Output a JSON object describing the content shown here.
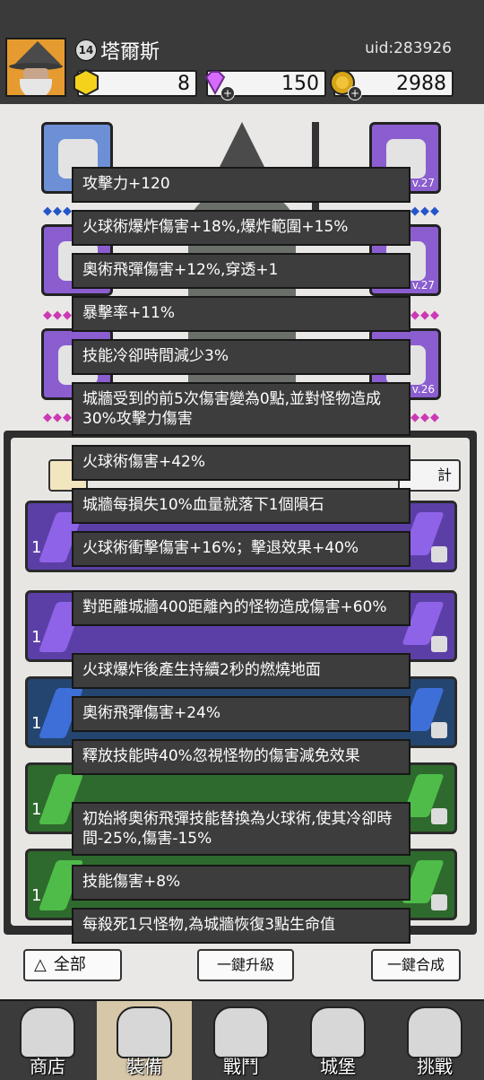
{
  "header": {
    "level": "14",
    "player_name": "塔爾斯",
    "uid": "uid:283926",
    "resources": [
      {
        "name": "gold-hex",
        "value": "8",
        "icon": "hexagon-coin-icon",
        "color": "#f4d21c"
      },
      {
        "name": "gems",
        "value": "150",
        "icon": "diamond-icon",
        "color": "#d86bff"
      },
      {
        "name": "coins",
        "value": "2988",
        "icon": "gold-coin-icon",
        "color": "#d6a417"
      }
    ],
    "plus": "+"
  },
  "equipment": {
    "levels": [
      "v.27",
      "v.27",
      "v.26"
    ],
    "diamond_rows": [
      "◆◆◆",
      "◆◆◆",
      "◆◆◆"
    ]
  },
  "inventory": {
    "stat_tab": "計",
    "cards": [
      {
        "count": "1",
        "rarity": "purple"
      },
      {
        "count": "1",
        "rarity": "purple"
      },
      {
        "count": "1",
        "rarity": "blue"
      },
      {
        "count": "1",
        "rarity": "green"
      },
      {
        "count": "1",
        "rarity": "green"
      }
    ],
    "buttons": {
      "all": "全部",
      "upgrade": "一鍵升級",
      "merge": "一鍵合成"
    }
  },
  "tooltip": {
    "lines": [
      "攻擊力+120",
      "火球術爆炸傷害+18%,爆炸範圍+15%",
      "奧術飛彈傷害+12%,穿透+1",
      "暴擊率+11%",
      "技能冷卻時間減少3%",
      "城牆受到的前5次傷害變為0點,並對怪物造成30%攻擊力傷害",
      "火球術傷害+42%",
      "城牆每損失10%血量就落下1個隕石",
      "火球術衝擊傷害+16%；擊退效果+40%",
      "對距離城牆400距離內的怪物造成傷害+60%",
      "火球爆炸後產生持續2秒的燃燒地面",
      "奧術飛彈傷害+24%",
      "釋放技能時40%忽視怪物的傷害減免效果",
      "初始將奧術飛彈技能替換為火球術,使其冷卻時間-25%,傷害-15%",
      "技能傷害+8%",
      "每殺死1只怪物,為城牆恢復3點生命值"
    ]
  },
  "nav": {
    "items": [
      {
        "label": "商店",
        "icon": "shop-icon"
      },
      {
        "label": "裝備",
        "icon": "backpack-icon",
        "active": true
      },
      {
        "label": "戰鬥",
        "icon": "crossed-swords-icon"
      },
      {
        "label": "城堡",
        "icon": "castle-icon"
      },
      {
        "label": "挑戰",
        "icon": "challenge-helmet-icon"
      }
    ]
  }
}
